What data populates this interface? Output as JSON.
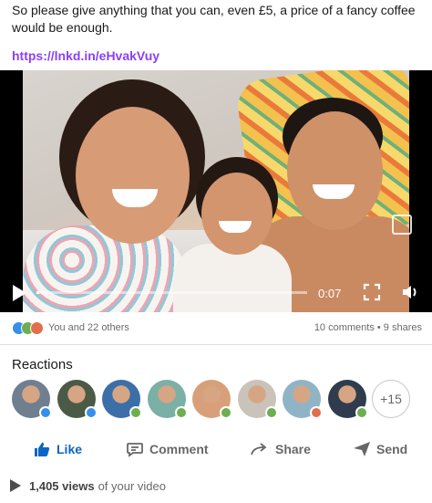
{
  "post": {
    "text": "So please give anything that you can, even £5, a price of a fancy coffee would be enough.",
    "link": "https://lnkd.in/eHvakVuy"
  },
  "video": {
    "time": "0:07",
    "progress": 0.01
  },
  "social": {
    "reactors": "You and 22 others",
    "comments_shares": "10 comments • 9 shares"
  },
  "reactions": {
    "title": "Reactions",
    "more_count": "+15",
    "avatars": [
      {
        "badge": "like",
        "color": "#6f7f8f"
      },
      {
        "badge": "like",
        "color": "#4a5a46"
      },
      {
        "badge": "celebrate",
        "color": "#3c6ea8"
      },
      {
        "badge": "celebrate",
        "color": "#7ab0a6"
      },
      {
        "badge": "celebrate",
        "color": "#d8a07a"
      },
      {
        "badge": "celebrate",
        "color": "#c9c3ba"
      },
      {
        "badge": "love",
        "color": "#8fb4c6"
      },
      {
        "badge": "celebrate",
        "color": "#2f3c4d"
      }
    ],
    "badge_colors": {
      "like": "#378fe9",
      "celebrate": "#6dae4f",
      "love": "#df704d"
    }
  },
  "actions": {
    "like": "Like",
    "comment": "Comment",
    "share": "Share",
    "send": "Send"
  },
  "views": {
    "count": "1,405 views",
    "suffix": "of your video"
  },
  "colors": {
    "link": "#8a3ffc",
    "like_blue": "#0a66c2"
  }
}
